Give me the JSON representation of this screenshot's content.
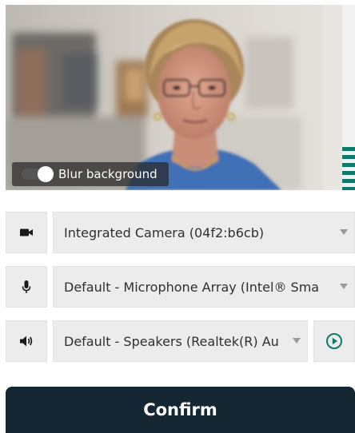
{
  "preview": {
    "blur_label": "Blur background",
    "blur_enabled": true
  },
  "camera": {
    "icon": "video-camera-icon",
    "selected": "Integrated Camera (04f2:b6cb)"
  },
  "microphone": {
    "icon": "microphone-icon",
    "selected": "Default - Microphone Array (Intel® Sma"
  },
  "speaker": {
    "icon": "speaker-icon",
    "selected": "Default - Speakers (Realtek(R) Au",
    "test_icon": "play-circle-icon"
  },
  "confirm_label": "Confirm",
  "colors": {
    "confirm_bg": "#152732",
    "control_bg": "#ececec",
    "accent_teal": "#0f7a6c"
  }
}
